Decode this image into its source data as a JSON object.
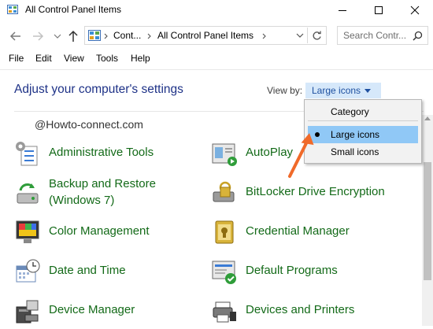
{
  "window": {
    "title": "All Control Panel Items",
    "controls": {
      "minimize": "minimize",
      "maximize": "maximize",
      "close": "close"
    }
  },
  "address": {
    "segments": [
      "Cont...",
      "All Control Panel Items"
    ],
    "search_placeholder": "Search Contr..."
  },
  "menu": {
    "items": [
      "File",
      "Edit",
      "View",
      "Tools",
      "Help"
    ]
  },
  "main": {
    "heading": "Adjust your computer's settings",
    "view_by_label": "View by:",
    "view_by_value": "Large icons",
    "watermark": "@Howto-connect.com"
  },
  "dropdown": {
    "options": [
      "Category",
      "Large icons",
      "Small icons"
    ],
    "selected": "Large icons"
  },
  "items": [
    {
      "label": "Administrative Tools",
      "icon": "administrative-tools-icon"
    },
    {
      "label": "AutoPlay",
      "icon": "autoplay-icon"
    },
    {
      "label": "Backup and Restore",
      "label2": "(Windows 7)",
      "icon": "backup-restore-icon"
    },
    {
      "label": "BitLocker Drive Encryption",
      "icon": "bitlocker-icon"
    },
    {
      "label": "Color Management",
      "icon": "color-management-icon"
    },
    {
      "label": "Credential Manager",
      "icon": "credential-manager-icon"
    },
    {
      "label": "Date and Time",
      "icon": "date-time-icon"
    },
    {
      "label": "Default Programs",
      "icon": "default-programs-icon"
    },
    {
      "label": "Device Manager",
      "icon": "device-manager-icon"
    },
    {
      "label": "Devices and Printers",
      "icon": "devices-printers-icon"
    }
  ],
  "colors": {
    "link": "#136a18",
    "heading": "#1e3287",
    "highlight": "#90c8f6",
    "arrow": "#f06a2a"
  }
}
